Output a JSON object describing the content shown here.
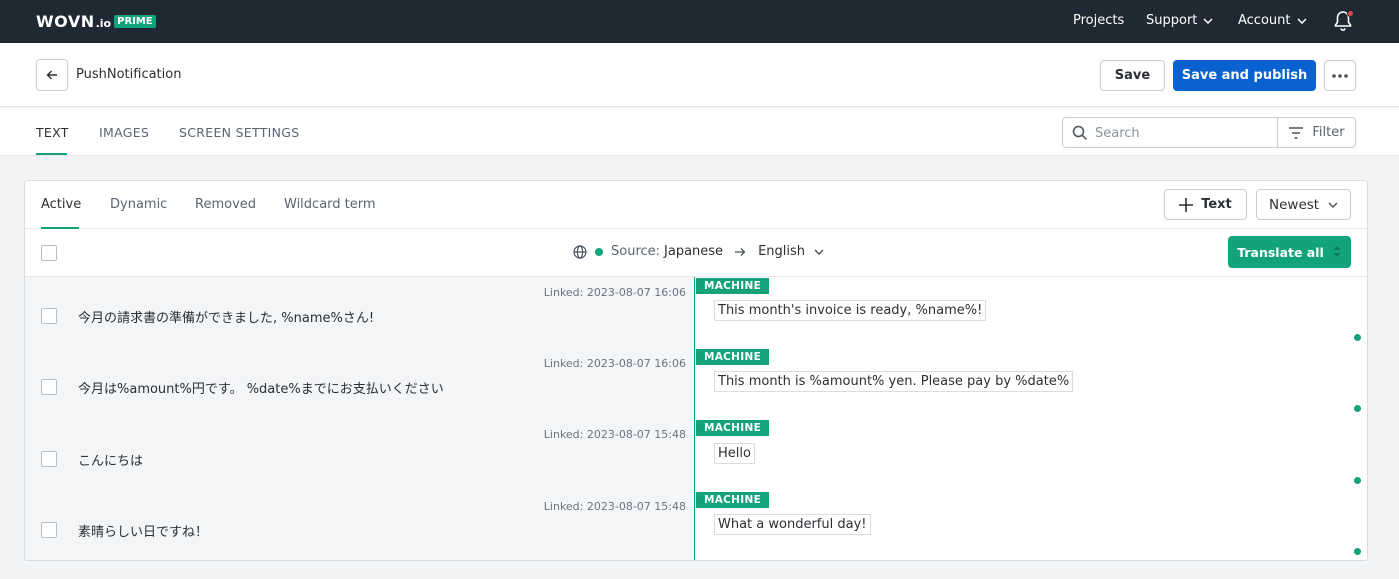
{
  "topnav": {
    "brand": "WOVN",
    "brand_suffix": ".io",
    "plan_badge": "PRIME",
    "projects": "Projects",
    "support": "Support",
    "account": "Account"
  },
  "header": {
    "title": "PushNotification",
    "save": "Save",
    "save_publish": "Save and publish"
  },
  "tabs": [
    "TEXT",
    "IMAGES",
    "SCREEN SETTINGS"
  ],
  "search": {
    "placeholder": "Search"
  },
  "filter": "Filter",
  "subtabs": [
    "Active",
    "Dynamic",
    "Removed",
    "Wildcard term"
  ],
  "add_text": "Text",
  "sort": "Newest",
  "language": {
    "source_label": "Source:",
    "source": "Japanese",
    "target": "English"
  },
  "translate_all": "Translate all",
  "rows": [
    {
      "linked": "Linked: 2023-08-07 16:06",
      "source": "今月の請求書の準備ができました, %name%さん!",
      "badge": "MACHINE",
      "translation": "This month's invoice is ready, %name%!"
    },
    {
      "linked": "Linked: 2023-08-07 16:06",
      "source": "今月は%amount%円です。 %date%までにお支払いください",
      "badge": "MACHINE",
      "translation": "This month is %amount% yen. Please pay by %date%"
    },
    {
      "linked": "Linked: 2023-08-07 15:48",
      "source": "こんにちは",
      "badge": "MACHINE",
      "translation": "Hello"
    },
    {
      "linked": "Linked: 2023-08-07 15:48",
      "source": "素晴らしい日ですね！",
      "badge": "MACHINE",
      "translation": "What a wonderful day!"
    }
  ],
  "colors": {
    "accent": "#12a37a",
    "primary": "#0a62d0",
    "topbar": "#1f2933",
    "notification": "#e5484d"
  },
  "icons": [
    "back-arrow-icon",
    "more-icon",
    "search-icon",
    "filter-icon",
    "plus-icon",
    "chevron-down-icon",
    "globe-icon",
    "arrow-right-icon",
    "bell-icon",
    "sort-updown-icon"
  ]
}
